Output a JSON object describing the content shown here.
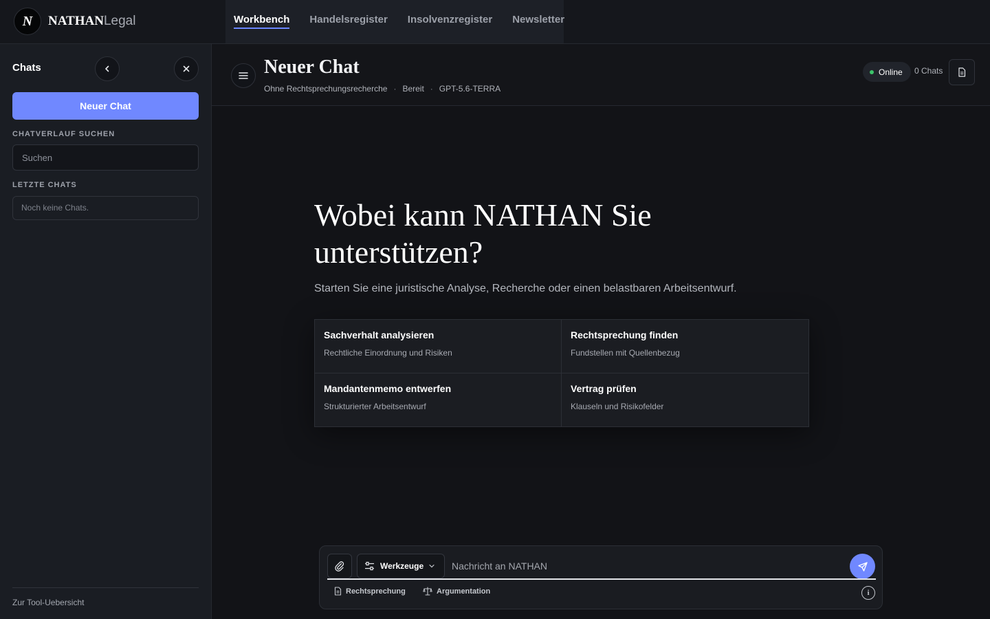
{
  "brand": {
    "logo_letter": "N",
    "name_bold": "NATHAN",
    "name_light": "Legal"
  },
  "nav": {
    "tabs": [
      {
        "label": "Workbench",
        "active": true
      },
      {
        "label": "Handelsregister",
        "active": false
      },
      {
        "label": "Insolvenzregister",
        "active": false
      },
      {
        "label": "Newsletter",
        "active": false
      }
    ]
  },
  "sidebar": {
    "title": "Chats",
    "new_chat_label": "Neuer Chat",
    "search_label": "CHATVERLAUF SUCHEN",
    "search_placeholder": "Suchen",
    "recent_label": "LETZTE CHATS",
    "empty_text": "Noch keine Chats.",
    "footer_link": "Zur Tool-Uebersicht"
  },
  "header": {
    "title": "Neuer Chat",
    "meta": [
      "Ohne Rechtsprechungsrecherche",
      "Bereit",
      "GPT-5.6-TERRA"
    ],
    "meta_separator": "·",
    "status": "Online",
    "chat_count": "0 Chats"
  },
  "hero": {
    "title": "Wobei kann NATHAN Sie unterstützen?",
    "subtitle": "Starten Sie eine juristische Analyse, Recherche oder einen belastbaren Arbeitsentwurf."
  },
  "cards": [
    {
      "title": "Sachverhalt analysieren",
      "desc": "Rechtliche Einordnung und Risiken"
    },
    {
      "title": "Rechtsprechung finden",
      "desc": "Fundstellen mit Quellenbezug"
    },
    {
      "title": "Mandantenmemo entwerfen",
      "desc": "Strukturierter Arbeitsentwurf"
    },
    {
      "title": "Vertrag prüfen",
      "desc": "Klauseln und Risikofelder"
    }
  ],
  "composer": {
    "tools_label": "Werkzeuge",
    "placeholder": "Nachricht an NATHAN",
    "chips": [
      "Rechtsprechung",
      "Argumentation"
    ],
    "info_glyph": "i"
  },
  "icons": {
    "sidebar_back": "chevron-left-icon",
    "sidebar_close": "close-icon",
    "menu": "menu-icon",
    "document": "document-icon",
    "attach": "paperclip-icon",
    "tools": "sliders-icon",
    "send": "send-icon",
    "case_law": "document-icon",
    "argumentation": "scale-icon",
    "info": "info-icon"
  },
  "colors": {
    "accent": "#7088ff",
    "status_online": "#3cc46a",
    "background": "#121317",
    "sidebar": "#1a1d23"
  }
}
